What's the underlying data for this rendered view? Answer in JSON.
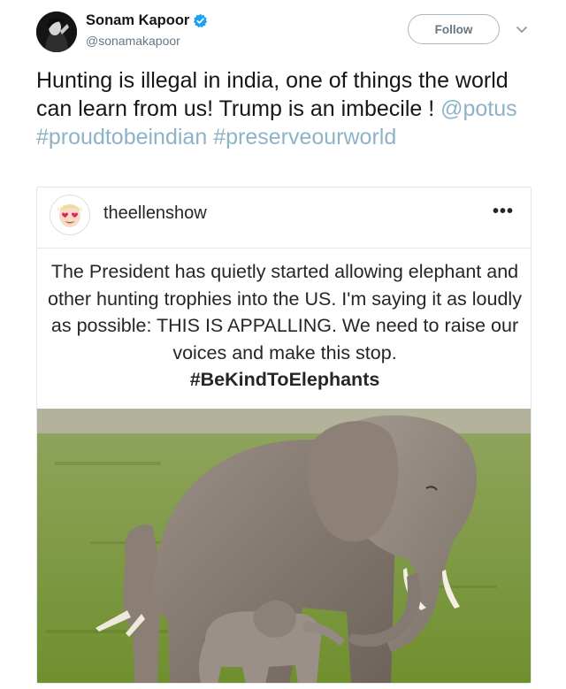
{
  "author": {
    "name": "Sonam Kapoor",
    "handle": "@sonamakapoor",
    "verified_icon": "verified-badge-icon",
    "follow_label": "Follow"
  },
  "tweet": {
    "text": "Hunting is illegal in india, one of things the world can learn from us! Trump is an imbecile ! ",
    "mention": "@potus",
    "hashtag1": "#proudtobeindian",
    "hashtag2": "#preserveourworld"
  },
  "embedded_post": {
    "username": "theellenshow",
    "more_glyph": "•••",
    "quote": "The President has quietly started allowing elephant and other hunting trophies into the US. I'm saying it as loudly as possible: THIS IS APPALLING. We need to raise our voices and make this stop.",
    "hashtag": "#BeKindToElephants",
    "image_alt": "elephants"
  },
  "colors": {
    "text": "#14171a",
    "muted": "#657786",
    "link": "#8eb3c7",
    "verified": "#1da1f2"
  }
}
